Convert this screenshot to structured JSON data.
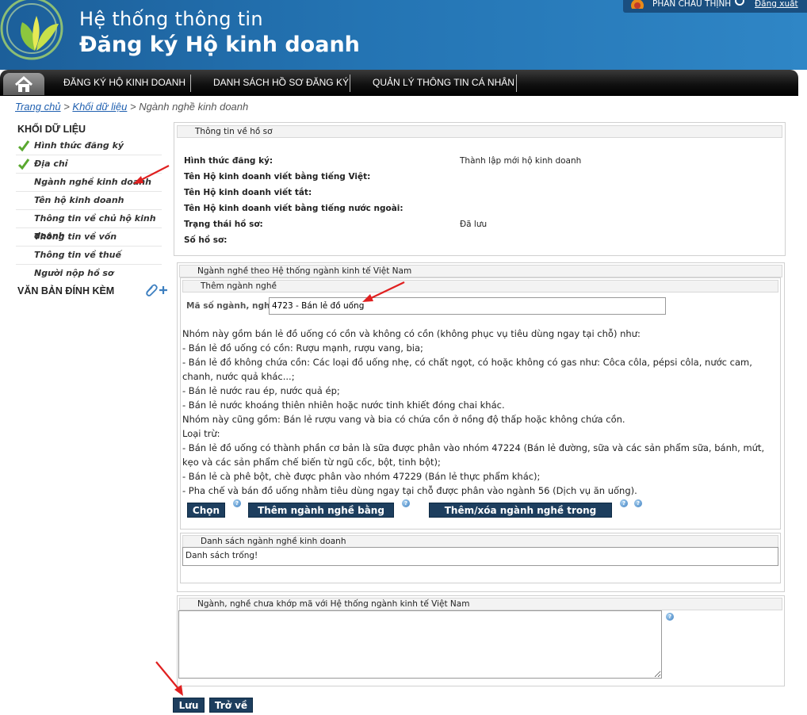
{
  "header": {
    "title_line1": "Hệ thống thông tin",
    "title_line2": "Đăng ký Hộ kinh doanh",
    "user_name": "PHAN CHÂU THỊNH",
    "logout_label": "Đăng xuất"
  },
  "nav": {
    "items": [
      "ĐĂNG KÝ HỘ KINH DOANH",
      "DANH SÁCH HỒ SƠ ĐĂNG KÝ",
      "QUẢN LÝ THÔNG TIN CÁ NHÂN"
    ]
  },
  "breadcrumb": {
    "home": "Trang chủ",
    "section": "Khối dữ liệu",
    "current": "Ngành nghề kinh doanh",
    "sep": " > "
  },
  "sidebar": {
    "heading": "KHỐI DỮ LIỆU",
    "items": [
      {
        "label": "Hình thức đăng ký",
        "done": true
      },
      {
        "label": "Địa chỉ",
        "done": true
      },
      {
        "label": "Ngành nghề kinh doanh",
        "done": false
      },
      {
        "label": "Tên hộ kinh doanh",
        "done": false
      },
      {
        "label": "Thông tin về chủ hộ kinh doanh",
        "done": false
      },
      {
        "label": "Thông tin về vốn",
        "done": false
      },
      {
        "label": "Thông tin về thuế",
        "done": false
      },
      {
        "label": "Người nộp hồ sơ",
        "done": false
      }
    ],
    "attachments_heading": "VĂN BẢN ĐÍNH KÈM"
  },
  "record_info": {
    "heading": "Thông tin về hồ sơ",
    "rows": [
      {
        "label": "Hình thức đăng ký:",
        "value": "Thành lập mới hộ kinh doanh"
      },
      {
        "label": "Tên Hộ kinh doanh viết bằng tiếng Việt:",
        "value": ""
      },
      {
        "label": "Tên Hộ kinh doanh viết tắt:",
        "value": ""
      },
      {
        "label": "Tên Hộ kinh doanh viết bằng tiếng nước ngoài:",
        "value": ""
      },
      {
        "label": "Trạng thái hồ sơ:",
        "value": "Đã lưu"
      },
      {
        "label": "Số hồ sơ:",
        "value": ""
      }
    ]
  },
  "industry": {
    "heading": "Ngành nghề theo Hệ thống ngành kinh tế Việt Nam",
    "add_heading": "Thêm ngành nghề",
    "code_label": "Mã số ngành, nghề",
    "code_value": "4723 - Bán lẻ đồ uống",
    "description_lines": [
      "Nhóm này gồm bán lẻ đồ uống có cồn và không có cồn (không phục vụ tiêu dùng ngay tại chỗ) như:",
      "- Bán lẻ đồ uống có cồn: Rượu mạnh, rượu vang, bia;",
      "- Bán lẻ đồ không chứa cồn: Các loại đồ uống nhẹ, có chất ngọt, có hoặc không có gas như: Côca côla, pépsi côla, nước cam, chanh, nước quả khác...;",
      "- Bán lẻ nước rau ép, nước quả ép;",
      "- Bán lẻ nước khoáng thiên nhiên hoặc nước tinh khiết đóng chai khác.",
      "Nhóm này cũng gồm: Bán lẻ rượu vang và bia có chứa cồn ở nồng độ thấp hoặc không chứa cồn.",
      "Loại trừ:",
      "- Bán lẻ đồ uống có thành phần cơ bản là sữa được phân vào nhóm 47224 (Bán lẻ đường, sữa và các sản phẩm sữa, bánh, mứt, kẹo và các sản phẩm chế biến từ ngũ cốc, bột, tinh bột);",
      "- Bán lẻ cà phê bột, chè được phân vào nhóm 47229 (Bán lẻ thực phẩm khác);",
      "- Pha chế và bán đồ uống nhằm tiêu dùng ngay tại chỗ được phân vào ngành 56 (Dịch vụ ăn uống)."
    ],
    "btn_choose": "Chọn",
    "btn_add_by_code": "Thêm ngành nghề bằng mã số",
    "btn_add_remove_list": "Thêm/xóa ngành nghề trong danh sách",
    "help_glyph": "?",
    "list_heading": "Danh sách ngành nghề kinh doanh",
    "list_empty": "Danh sách trống!"
  },
  "unmatched": {
    "heading": "Ngành, nghề chưa khớp mã với Hệ thống ngành kinh tế Việt Nam",
    "value": ""
  },
  "actions": {
    "save_label": "Lưu",
    "back_label": "Trở về"
  },
  "colors": {
    "header_blue": "#2474b3",
    "button_navy": "#1d3e5e",
    "annotation_red": "#e02020"
  }
}
